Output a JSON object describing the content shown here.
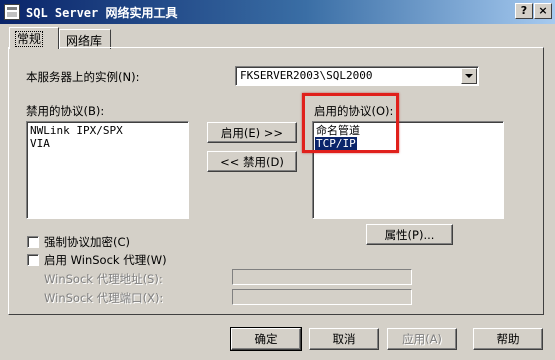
{
  "window": {
    "title": "SQL Server 网络实用工具",
    "title_buttons": [
      "?",
      "×"
    ]
  },
  "tabs": [
    {
      "label": "常规",
      "active": true
    },
    {
      "label": "网络库",
      "active": false
    }
  ],
  "instance": {
    "label": "本服务器上的实例(N):",
    "value": "FKSERVER2003\\SQL2000"
  },
  "disabled_protocols": {
    "label": "禁用的协议(B):",
    "items": [
      "NWLink IPX/SPX",
      "VIA"
    ]
  },
  "enabled_protocols": {
    "label": "启用的协议(O):",
    "items": [
      "命名管道",
      "TCP/IP"
    ],
    "selected_index": 1
  },
  "buttons": {
    "enable": "启用(E) >>",
    "disable": "<< 禁用(D)",
    "properties": "属性(P)...",
    "ok": "确定",
    "cancel": "取消",
    "apply": "应用(A)",
    "help": "帮助"
  },
  "options": {
    "force_encryption": {
      "label": "强制协议加密(C)",
      "checked": false
    },
    "enable_winsock": {
      "label": "启用 WinSock 代理(W)",
      "checked": false
    },
    "winsock_address_label": "WinSock 代理地址(S):",
    "winsock_port_label": "WinSock 代理端口(X):",
    "winsock_address_value": "",
    "winsock_port_value": ""
  },
  "colors": {
    "dialog_bg": "#d4d0c8",
    "title_bar": "#0a246a",
    "selection": "#0a246a",
    "annotation_box": "#e0201b"
  }
}
